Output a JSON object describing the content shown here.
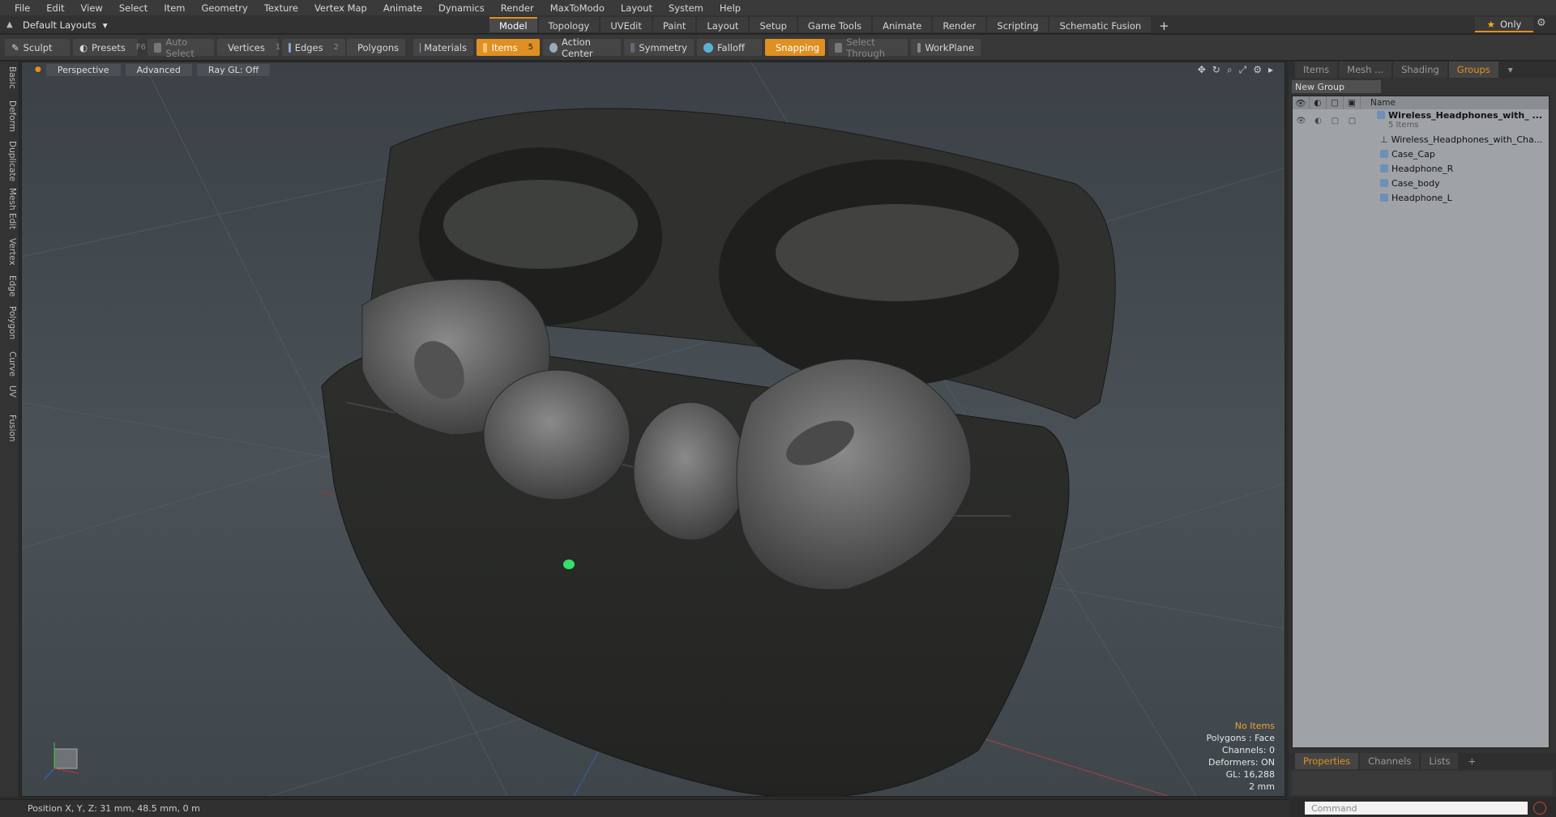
{
  "menu": [
    "File",
    "Edit",
    "View",
    "Select",
    "Item",
    "Geometry",
    "Texture",
    "Vertex Map",
    "Animate",
    "Dynamics",
    "Render",
    "MaxToModo",
    "Layout",
    "System",
    "Help"
  ],
  "layout_select": "Default Layouts",
  "layout_tabs": [
    "Model",
    "Topology",
    "UVEdit",
    "Paint",
    "Layout",
    "Setup",
    "Game Tools",
    "Animate",
    "Render",
    "Scripting",
    "Schematic Fusion"
  ],
  "layout_active": "Model",
  "only_label": "Only",
  "toolbar": {
    "sculpt": "Sculpt",
    "presets": "Presets",
    "presets_key": "F6",
    "auto_select": "Auto Select",
    "vertices": "Vertices",
    "vertices_key": "1",
    "edges": "Edges",
    "edges_key": "2",
    "polygons": "Polygons",
    "materials": "Materials",
    "items": "Items",
    "items_key": "5",
    "action_center": "Action Center",
    "symmetry": "Symmetry",
    "falloff": "Falloff",
    "snapping": "Snapping",
    "select_through": "Select Through",
    "workplane": "WorkPlane"
  },
  "left_tabs": [
    "Basic",
    "Deform",
    "Duplicate",
    "Mesh Edit",
    "Vertex",
    "Edge",
    "Polygon",
    "Curve",
    "UV",
    "Fusion"
  ],
  "viewport": {
    "view": "Perspective",
    "mode": "Advanced",
    "raygl": "Ray GL: Off",
    "info": {
      "selection": "No Items",
      "polygons": "Polygons : Face",
      "channels": "Channels: 0",
      "deformers": "Deformers: ON",
      "gl": "GL: 16,288",
      "scale": "2 mm"
    }
  },
  "right_panel": {
    "tabs": [
      "Items",
      "Mesh ...",
      "Shading",
      "Groups"
    ],
    "active_tab": "Groups",
    "new_group": "New Group",
    "column_name": "Name",
    "group": {
      "name": "Wireless_Headphones_with_ ...",
      "count": "5 Items",
      "children": [
        "Wireless_Headphones_with_Cha...",
        "Case_Cap",
        "Headphone_R",
        "Case_body",
        "Headphone_L"
      ]
    },
    "bottom_tabs": [
      "Properties",
      "Channels",
      "Lists"
    ],
    "bottom_active": "Properties"
  },
  "statusbar": {
    "position": "Position X, Y, Z:   31 mm, 48.5 mm, 0 m"
  },
  "command_placeholder": "Command",
  "colors": {
    "accent": "#e4901d",
    "viewport_bg": "#454c51"
  }
}
